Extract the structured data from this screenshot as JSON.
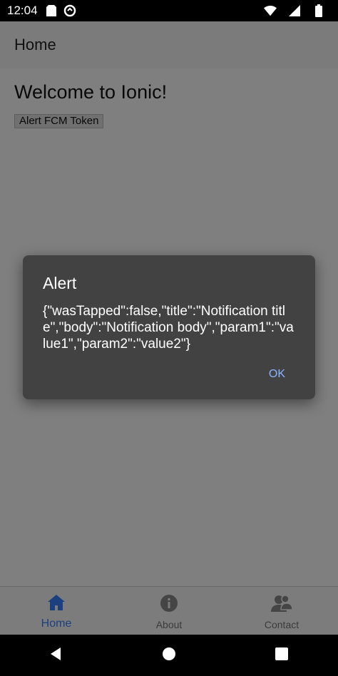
{
  "status_bar": {
    "time": "12:04",
    "icons": [
      "sd-card-icon",
      "sync-icon",
      "wifi-icon",
      "signal-icon",
      "battery-icon"
    ]
  },
  "header": {
    "title": "Home"
  },
  "main": {
    "welcome": "Welcome to Ionic!",
    "alert_button_label": "Alert FCM Token"
  },
  "tabs": [
    {
      "label": "Home",
      "icon": "home-icon",
      "active": true
    },
    {
      "label": "About",
      "icon": "info-icon",
      "active": false
    },
    {
      "label": "Contact",
      "icon": "contacts-icon",
      "active": false
    }
  ],
  "dialog": {
    "title": "Alert",
    "message": "{\"wasTapped\":false,\"title\":\"Notification title\",\"body\":\"Notification body\",\"param1\":\"value1\",\"param2\":\"value2\"}",
    "ok_label": "OK"
  },
  "colors": {
    "accent": "#3880ff",
    "dialog_bg": "#424242",
    "dialog_button": "#8ab4ff"
  },
  "nav_buttons": [
    "back-icon",
    "home-circle-icon",
    "recents-icon"
  ]
}
